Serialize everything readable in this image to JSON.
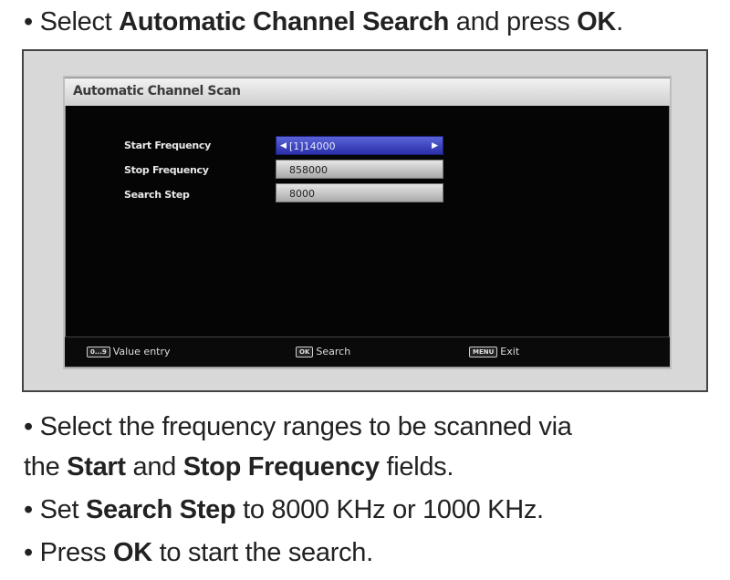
{
  "instructions": {
    "line1": {
      "prefix": "• Select ",
      "bold1": "Automatic Channel Search",
      "middle": " and press ",
      "bold2": "OK",
      "suffix": "."
    },
    "line2": {
      "text": "• Select the frequency ranges to be scanned via"
    },
    "line3": {
      "prefix": "the ",
      "bold1": "Start",
      "middle": " and ",
      "bold2": "Stop Frequency",
      "suffix": " fields."
    },
    "line4": {
      "prefix": "• Set ",
      "bold1": "Search Step",
      "suffix": " to 8000 KHz or 1000 KHz."
    },
    "line5": {
      "prefix": "• Press ",
      "bold1": "OK",
      "suffix": " to start the search."
    }
  },
  "tv_menu": {
    "title": "Automatic Channel Scan",
    "items": [
      {
        "label": "Start Frequency",
        "value": "[1]14000",
        "selected": true
      },
      {
        "label": "Stop Frequency",
        "value": "858000",
        "selected": false
      },
      {
        "label": "Search Step",
        "value": "8000",
        "selected": false
      }
    ],
    "footer": [
      {
        "key": "0...9",
        "label": "Value entry"
      },
      {
        "key": "OK",
        "label": "Search"
      },
      {
        "key": "MENU",
        "label": "Exit"
      }
    ]
  },
  "colors": {
    "selected_field": "#3a42c0",
    "screen_background": "#050505",
    "frame_background": "#d8d8d8"
  },
  "icons": {
    "left_arrow": "triangle-left-icon",
    "right_arrow": "triangle-right-icon"
  }
}
